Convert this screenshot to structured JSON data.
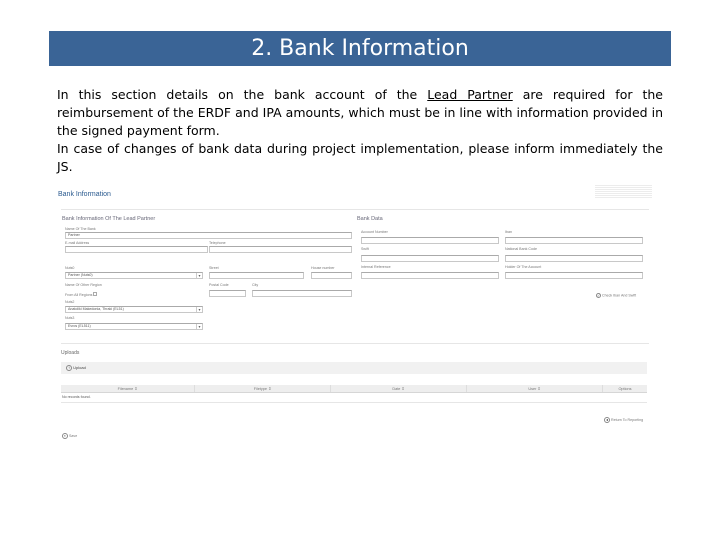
{
  "slide": {
    "title": "2. Bank Information",
    "intro": {
      "p1_before": "In this section details on the bank account of the ",
      "p1_link": "Lead Partner",
      "p1_after": " are required for the reimbursement of the ERDF and IPA amounts, which must be in line with information provided in the signed payment form.",
      "p2": "In case of changes of bank data during project implementation, please inform immediately the JS."
    }
  },
  "form": {
    "page_title": "Bank Information",
    "lead_partner_section": {
      "heading": "Bank Information Of The Lead Partner",
      "name_of_bank_label": "Name Of The Bank",
      "name_of_bank_value": "Partner",
      "email_label": "E-mail Address",
      "email_value": "",
      "telephone_label": "Telephone",
      "telephone_value": "",
      "nuts0_label": "Nuts0",
      "nuts0_value": "Partner (Nuts0)",
      "street_label": "Street",
      "street_value": "",
      "house_number_label": "House number",
      "house_number_value": "",
      "name_other_region_label": "Name Of Other Region",
      "postal_code_label": "Postal Code",
      "postal_code_value": "",
      "city_label": "City",
      "city_value": "",
      "from_all_regions_label": "From All Regions",
      "nuts2_label": "Nuts2",
      "nuts2_value": "Anatoliki Makedonia, Thraki (EL51)",
      "nuts3_label": "Nuts3",
      "nuts3_value": "Evros (EL511)"
    },
    "bank_data_section": {
      "heading": "Bank Data",
      "account_number_label": "Account Number",
      "iban_label": "Iban",
      "swift_label": "Swift",
      "national_bank_code_label": "National Bank Code",
      "internal_reference_label": "Internal Reference",
      "holder_label": "Holder Of The Account",
      "check_label": "Check Iban And Swift"
    },
    "uploads": {
      "heading": "Uploads",
      "upload_button": "Upload",
      "columns": [
        "Filename ⇕",
        "Filetype ⇕",
        "Date ⇕",
        "User ⇕",
        "Options"
      ],
      "empty_text": "No records found."
    },
    "return_label": "Return To Reporting",
    "save_label": "Save",
    "icons": {
      "dropdown": "▾",
      "upload": "↑",
      "check": "✓",
      "return": "◂",
      "save": "▪"
    }
  }
}
